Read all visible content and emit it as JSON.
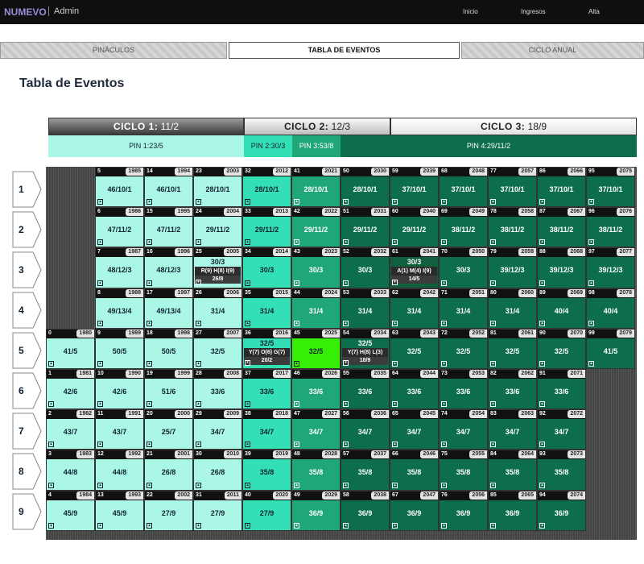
{
  "topbar": {
    "brand": "NUMEVO",
    "section": "Admin",
    "nav": [
      "Inicio",
      "Ingresos",
      "Alta"
    ]
  },
  "tabs": [
    "PINÁCULOS",
    "TABLA DE EVENTOS",
    "CICLO ANUAL"
  ],
  "page_title": "Tabla de Eventos",
  "ciclos": [
    {
      "label": "CICLO 1:",
      "value": "11/2"
    },
    {
      "label": "CICLO 2:",
      "value": "12/3"
    },
    {
      "label": "CICLO 3:",
      "value": "18/9"
    }
  ],
  "pins": [
    "PIN 1:23/5",
    "PIN 2:30/3",
    "PIN 3:53/8",
    "PIN 4:29/11/2"
  ],
  "row_labels": [
    "1",
    "2",
    "3",
    "4",
    "5",
    "6",
    "7",
    "8",
    "9"
  ],
  "colors": {
    "c1": "#a9f7e4",
    "c2": "#33e0b5",
    "c3": "#20a777",
    "c4": "#0d6e4b",
    "bright": "#37ee05",
    "dark": "#105f3e"
  },
  "cells": [
    {
      "r": 0,
      "c": 1,
      "n": "5",
      "y": "1985",
      "v": "46/10/1"
    },
    {
      "r": 0,
      "c": 2,
      "n": "14",
      "y": "1994",
      "v": "46/10/1"
    },
    {
      "r": 0,
      "c": 3,
      "n": "23",
      "y": "2003",
      "v": "28/10/1"
    },
    {
      "r": 0,
      "c": 4,
      "n": "32",
      "y": "2012",
      "v": "28/10/1"
    },
    {
      "r": 0,
      "c": 5,
      "n": "41",
      "y": "2021",
      "v": "28/10/1"
    },
    {
      "r": 0,
      "c": 6,
      "n": "50",
      "y": "2030",
      "v": "28/10/1"
    },
    {
      "r": 0,
      "c": 7,
      "n": "59",
      "y": "2039",
      "v": "37/10/1"
    },
    {
      "r": 0,
      "c": 8,
      "n": "68",
      "y": "2048",
      "v": "37/10/1"
    },
    {
      "r": 0,
      "c": 9,
      "n": "77",
      "y": "2057",
      "v": "37/10/1"
    },
    {
      "r": 0,
      "c": 10,
      "n": "86",
      "y": "2066",
      "v": "37/10/1"
    },
    {
      "r": 0,
      "c": 11,
      "n": "95",
      "y": "2075",
      "v": "37/10/1"
    },
    {
      "r": 1,
      "c": 1,
      "n": "6",
      "y": "1986",
      "v": "47/11/2"
    },
    {
      "r": 1,
      "c": 2,
      "n": "15",
      "y": "1995",
      "v": "47/11/2"
    },
    {
      "r": 1,
      "c": 3,
      "n": "24",
      "y": "2004",
      "v": "29/11/2"
    },
    {
      "r": 1,
      "c": 4,
      "n": "33",
      "y": "2013",
      "v": "29/11/2"
    },
    {
      "r": 1,
      "c": 5,
      "n": "42",
      "y": "2022",
      "v": "29/11/2"
    },
    {
      "r": 1,
      "c": 6,
      "n": "51",
      "y": "2031",
      "v": "29/11/2"
    },
    {
      "r": 1,
      "c": 7,
      "n": "60",
      "y": "2040",
      "v": "29/11/2"
    },
    {
      "r": 1,
      "c": 8,
      "n": "69",
      "y": "2049",
      "v": "38/11/2"
    },
    {
      "r": 1,
      "c": 9,
      "n": "78",
      "y": "2058",
      "v": "38/11/2"
    },
    {
      "r": 1,
      "c": 10,
      "n": "87",
      "y": "2067",
      "v": "38/11/2"
    },
    {
      "r": 1,
      "c": 11,
      "n": "96",
      "y": "2076",
      "v": "38/11/2"
    },
    {
      "r": 2,
      "c": 1,
      "n": "7",
      "y": "1987",
      "v": "48/12/3"
    },
    {
      "r": 2,
      "c": 2,
      "n": "16",
      "y": "1996",
      "v": "48/12/3"
    },
    {
      "r": 2,
      "c": 3,
      "n": "25",
      "y": "2005",
      "v": "30/3",
      "s": "R(9) H(8) I(9)",
      "b": "26/8"
    },
    {
      "r": 2,
      "c": 4,
      "n": "34",
      "y": "2014",
      "v": "30/3"
    },
    {
      "r": 2,
      "c": 5,
      "n": "43",
      "y": "2023",
      "v": "30/3"
    },
    {
      "r": 2,
      "c": 6,
      "n": "52",
      "y": "2032",
      "v": "30/3"
    },
    {
      "r": 2,
      "c": 7,
      "n": "61",
      "y": "2041",
      "v": "30/3",
      "s": "A(1) M(4) I(9)",
      "b": "14/5"
    },
    {
      "r": 2,
      "c": 8,
      "n": "70",
      "y": "2050",
      "v": "30/3"
    },
    {
      "r": 2,
      "c": 9,
      "n": "79",
      "y": "2059",
      "v": "39/12/3"
    },
    {
      "r": 2,
      "c": 10,
      "n": "88",
      "y": "2068",
      "v": "39/12/3"
    },
    {
      "r": 2,
      "c": 11,
      "n": "97",
      "y": "2077",
      "v": "39/12/3"
    },
    {
      "r": 3,
      "c": 1,
      "n": "8",
      "y": "1988",
      "v": "49/13/4"
    },
    {
      "r": 3,
      "c": 2,
      "n": "17",
      "y": "1997",
      "v": "49/13/4"
    },
    {
      "r": 3,
      "c": 3,
      "n": "26",
      "y": "2006",
      "v": "31/4"
    },
    {
      "r": 3,
      "c": 4,
      "n": "35",
      "y": "2015",
      "v": "31/4"
    },
    {
      "r": 3,
      "c": 5,
      "n": "44",
      "y": "2024",
      "v": "31/4"
    },
    {
      "r": 3,
      "c": 6,
      "n": "53",
      "y": "2033",
      "v": "31/4"
    },
    {
      "r": 3,
      "c": 7,
      "n": "62",
      "y": "2042",
      "v": "31/4"
    },
    {
      "r": 3,
      "c": 8,
      "n": "71",
      "y": "2051",
      "v": "31/4"
    },
    {
      "r": 3,
      "c": 9,
      "n": "80",
      "y": "2060",
      "v": "31/4"
    },
    {
      "r": 3,
      "c": 10,
      "n": "89",
      "y": "2069",
      "v": "40/4"
    },
    {
      "r": 3,
      "c": 11,
      "n": "98",
      "y": "2078",
      "v": "40/4"
    },
    {
      "r": 4,
      "c": 0,
      "n": "0",
      "y": "1980",
      "v": "41/5"
    },
    {
      "r": 4,
      "c": 1,
      "n": "9",
      "y": "1989",
      "v": "50/5"
    },
    {
      "r": 4,
      "c": 2,
      "n": "18",
      "y": "1998",
      "v": "50/5"
    },
    {
      "r": 4,
      "c": 3,
      "n": "27",
      "y": "2007",
      "v": "32/5"
    },
    {
      "r": 4,
      "c": 4,
      "n": "36",
      "y": "2016",
      "v": "32/5",
      "s": "Y(7) O(6) G(7)",
      "b": "20/2"
    },
    {
      "r": 4,
      "c": 5,
      "n": "45",
      "y": "2025",
      "v": "32/5"
    },
    {
      "r": 4,
      "c": 6,
      "n": "54",
      "y": "2034",
      "v": "32/5",
      "s": "Y(7) H(8) L(3)",
      "b": "18/9"
    },
    {
      "r": 4,
      "c": 7,
      "n": "63",
      "y": "2043",
      "v": "32/5"
    },
    {
      "r": 4,
      "c": 8,
      "n": "72",
      "y": "2052",
      "v": "32/5"
    },
    {
      "r": 4,
      "c": 9,
      "n": "81",
      "y": "2061",
      "v": "32/5"
    },
    {
      "r": 4,
      "c": 10,
      "n": "90",
      "y": "2070",
      "v": "32/5"
    },
    {
      "r": 4,
      "c": 11,
      "n": "99",
      "y": "2079",
      "v": "41/5"
    },
    {
      "r": 5,
      "c": 0,
      "n": "1",
      "y": "1981",
      "v": "42/6"
    },
    {
      "r": 5,
      "c": 1,
      "n": "10",
      "y": "1990",
      "v": "42/6"
    },
    {
      "r": 5,
      "c": 2,
      "n": "19",
      "y": "1999",
      "v": "51/6"
    },
    {
      "r": 5,
      "c": 3,
      "n": "28",
      "y": "2008",
      "v": "33/6"
    },
    {
      "r": 5,
      "c": 4,
      "n": "37",
      "y": "2017",
      "v": "33/6"
    },
    {
      "r": 5,
      "c": 5,
      "n": "46",
      "y": "2026",
      "v": "33/6"
    },
    {
      "r": 5,
      "c": 6,
      "n": "55",
      "y": "2035",
      "v": "33/6"
    },
    {
      "r": 5,
      "c": 7,
      "n": "64",
      "y": "2044",
      "v": "33/6"
    },
    {
      "r": 5,
      "c": 8,
      "n": "73",
      "y": "2053",
      "v": "33/6"
    },
    {
      "r": 5,
      "c": 9,
      "n": "82",
      "y": "2062",
      "v": "33/6"
    },
    {
      "r": 5,
      "c": 10,
      "n": "91",
      "y": "2071",
      "v": "33/6"
    },
    {
      "r": 6,
      "c": 0,
      "n": "2",
      "y": "1982",
      "v": "43/7"
    },
    {
      "r": 6,
      "c": 1,
      "n": "11",
      "y": "1991",
      "v": "43/7"
    },
    {
      "r": 6,
      "c": 2,
      "n": "20",
      "y": "2000",
      "v": "25/7"
    },
    {
      "r": 6,
      "c": 3,
      "n": "29",
      "y": "2009",
      "v": "34/7"
    },
    {
      "r": 6,
      "c": 4,
      "n": "38",
      "y": "2018",
      "v": "34/7"
    },
    {
      "r": 6,
      "c": 5,
      "n": "47",
      "y": "2027",
      "v": "34/7"
    },
    {
      "r": 6,
      "c": 6,
      "n": "56",
      "y": "2036",
      "v": "34/7"
    },
    {
      "r": 6,
      "c": 7,
      "n": "65",
      "y": "2045",
      "v": "34/7"
    },
    {
      "r": 6,
      "c": 8,
      "n": "74",
      "y": "2054",
      "v": "34/7"
    },
    {
      "r": 6,
      "c": 9,
      "n": "83",
      "y": "2063",
      "v": "34/7"
    },
    {
      "r": 6,
      "c": 10,
      "n": "92",
      "y": "2072",
      "v": "34/7"
    },
    {
      "r": 7,
      "c": 0,
      "n": "3",
      "y": "1983",
      "v": "44/8"
    },
    {
      "r": 7,
      "c": 1,
      "n": "12",
      "y": "1992",
      "v": "44/8"
    },
    {
      "r": 7,
      "c": 2,
      "n": "21",
      "y": "2001",
      "v": "26/8"
    },
    {
      "r": 7,
      "c": 3,
      "n": "30",
      "y": "2010",
      "v": "26/8"
    },
    {
      "r": 7,
      "c": 4,
      "n": "39",
      "y": "2019",
      "v": "35/8"
    },
    {
      "r": 7,
      "c": 5,
      "n": "48",
      "y": "2028",
      "v": "35/8"
    },
    {
      "r": 7,
      "c": 6,
      "n": "57",
      "y": "2037",
      "v": "35/8"
    },
    {
      "r": 7,
      "c": 7,
      "n": "66",
      "y": "2046",
      "v": "35/8"
    },
    {
      "r": 7,
      "c": 8,
      "n": "75",
      "y": "2055",
      "v": "35/8"
    },
    {
      "r": 7,
      "c": 9,
      "n": "84",
      "y": "2064",
      "v": "35/8"
    },
    {
      "r": 7,
      "c": 10,
      "n": "93",
      "y": "2073",
      "v": "35/8"
    },
    {
      "r": 8,
      "c": 0,
      "n": "4",
      "y": "1984",
      "v": "45/9"
    },
    {
      "r": 8,
      "c": 1,
      "n": "13",
      "y": "1993",
      "v": "45/9"
    },
    {
      "r": 8,
      "c": 2,
      "n": "22",
      "y": "2002",
      "v": "27/9"
    },
    {
      "r": 8,
      "c": 3,
      "n": "31",
      "y": "2011",
      "v": "27/9"
    },
    {
      "r": 8,
      "c": 4,
      "n": "40",
      "y": "2020",
      "v": "27/9"
    },
    {
      "r": 8,
      "c": 5,
      "n": "49",
      "y": "2029",
      "v": "36/9"
    },
    {
      "r": 8,
      "c": 6,
      "n": "58",
      "y": "2038",
      "v": "36/9"
    },
    {
      "r": 8,
      "c": 7,
      "n": "67",
      "y": "2047",
      "v": "36/9"
    },
    {
      "r": 8,
      "c": 8,
      "n": "76",
      "y": "2056",
      "v": "36/9"
    },
    {
      "r": 8,
      "c": 9,
      "n": "85",
      "y": "2065",
      "v": "36/9"
    },
    {
      "r": 8,
      "c": 10,
      "n": "94",
      "y": "2074",
      "v": "36/9"
    }
  ]
}
